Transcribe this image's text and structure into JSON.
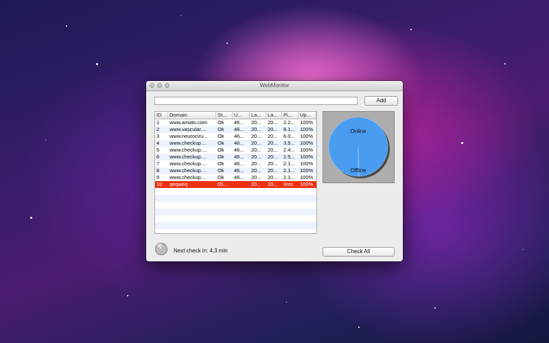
{
  "window": {
    "title": "WebMonitor"
  },
  "toolbar": {
    "url_value": "",
    "add_label": "Add"
  },
  "table": {
    "columns": [
      "ID",
      "Domain",
      "St...",
      "U...",
      "La...",
      "La...",
      "Pi...",
      "Up..."
    ],
    "rows": [
      {
        "id": "1",
        "domain": "www.amato.com",
        "status": "Ok",
        "u": "46...",
        "la1": "20...",
        "la2": "20...",
        "ping": "2.2...",
        "up": "100%",
        "state": "normal"
      },
      {
        "id": "2",
        "domain": "www.vascular....",
        "status": "Ok",
        "u": "46...",
        "la1": "20...",
        "la2": "20...",
        "ping": "8.1...",
        "up": "100%",
        "state": "normal"
      },
      {
        "id": "3",
        "domain": "www.neurociru...",
        "status": "Ok",
        "u": "46...",
        "la1": "20...",
        "la2": "20...",
        "ping": "6.0...",
        "up": "100%",
        "state": "normal"
      },
      {
        "id": "4",
        "domain": "www.checkup....",
        "status": "Ok",
        "u": "46...",
        "la1": "20...",
        "la2": "20...",
        "ping": "3.5...",
        "up": "100%",
        "state": "normal"
      },
      {
        "id": "5",
        "domain": "www.checkup....",
        "status": "Ok",
        "u": "46...",
        "la1": "20...",
        "la2": "20...",
        "ping": "2.4...",
        "up": "100%",
        "state": "normal"
      },
      {
        "id": "6",
        "domain": "www.checkup....",
        "status": "Ok",
        "u": "46...",
        "la1": "20...",
        "la2": "20...",
        "ping": "2.5...",
        "up": "100%",
        "state": "normal"
      },
      {
        "id": "7",
        "domain": "www.checkup....",
        "status": "Ok",
        "u": "46...",
        "la1": "20...",
        "la2": "20...",
        "ping": "2.1...",
        "up": "100%",
        "state": "normal"
      },
      {
        "id": "8",
        "domain": "www.checkup....",
        "status": "Ok",
        "u": "46...",
        "la1": "20...",
        "la2": "20...",
        "ping": "2.1...",
        "up": "100%",
        "state": "normal"
      },
      {
        "id": "9",
        "domain": "www.checkup....",
        "status": "Ok",
        "u": "46...",
        "la1": "20...",
        "la2": "20...",
        "ping": "2.1...",
        "up": "100%",
        "state": "normal"
      },
      {
        "id": "10",
        "domain": "qeqweq",
        "status": "05...",
        "u": "",
        "la1": "20...",
        "la2": "20...",
        "ping": "0ms",
        "up": "100%",
        "state": "error"
      }
    ]
  },
  "chart_data": {
    "type": "pie",
    "categories": [
      "Online",
      "Offline"
    ],
    "values": [
      99.5,
      0.5
    ],
    "colors": [
      "#4a9cf0",
      "#4a9cf0"
    ]
  },
  "footer": {
    "next_check_text": "Next check in: 4,3 min",
    "check_all_label": "Check All"
  },
  "colors": {
    "error_row": "#ee2f10",
    "pie_fill": "#4a9cf0",
    "alt_row": "#edf3fe"
  }
}
